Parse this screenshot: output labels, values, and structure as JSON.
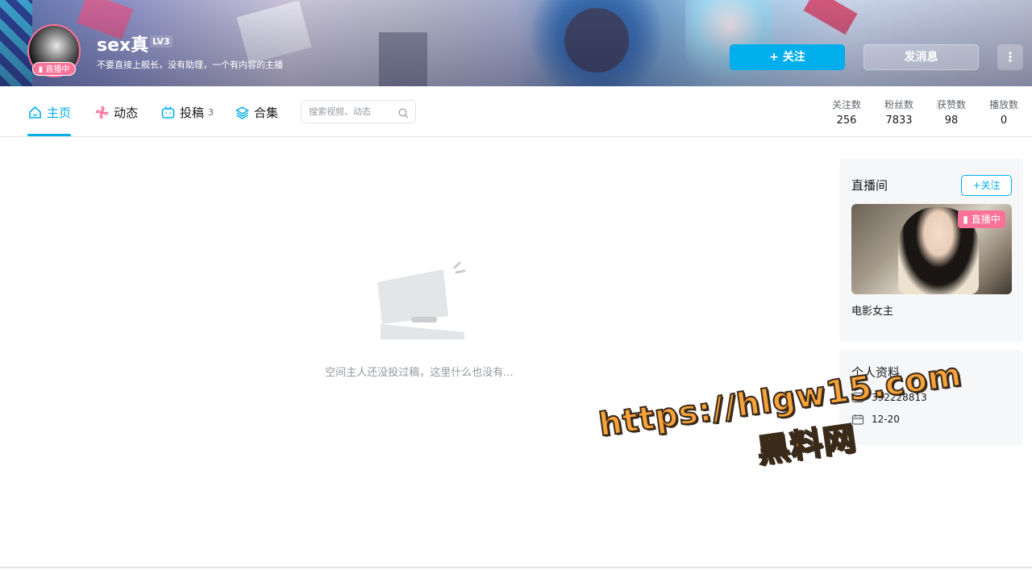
{
  "header": {
    "username": "sex真",
    "level": "LV3",
    "signature": "不要直接上舰长，没有助理，一个有内容的主播",
    "live_badge": "直播中",
    "follow_label": "+ 关注",
    "message_label": "发消息",
    "more_label": "⋮"
  },
  "nav": {
    "tabs": [
      {
        "label": "主页",
        "count": "",
        "icon": "home-icon"
      },
      {
        "label": "动态",
        "count": "",
        "icon": "pinwheel-icon"
      },
      {
        "label": "投稿",
        "count": "3",
        "icon": "tv-icon"
      },
      {
        "label": "合集",
        "count": "",
        "icon": "layers-icon"
      }
    ],
    "search_placeholder": "搜索视频、动态"
  },
  "stats": [
    {
      "label": "关注数",
      "value": "256"
    },
    {
      "label": "粉丝数",
      "value": "7833"
    },
    {
      "label": "获赞数",
      "value": "98"
    },
    {
      "label": "播放数",
      "value": "0"
    }
  ],
  "main": {
    "empty_text": "空间主人还没投过稿，这里什么也没有..."
  },
  "live_room": {
    "title": "直播间",
    "follow_label": "+关注",
    "live_tag": "直播中",
    "room_name": "电影女主"
  },
  "profile": {
    "title": "个人资料",
    "uid": "392228813",
    "birthday": "12-20"
  },
  "watermark": {
    "line1": "https://hlgw15.com",
    "line2": "黑料网"
  },
  "colors": {
    "accent": "#00aeec",
    "pink": "#fb7299",
    "text": "#18191c",
    "muted": "#9499a0"
  }
}
